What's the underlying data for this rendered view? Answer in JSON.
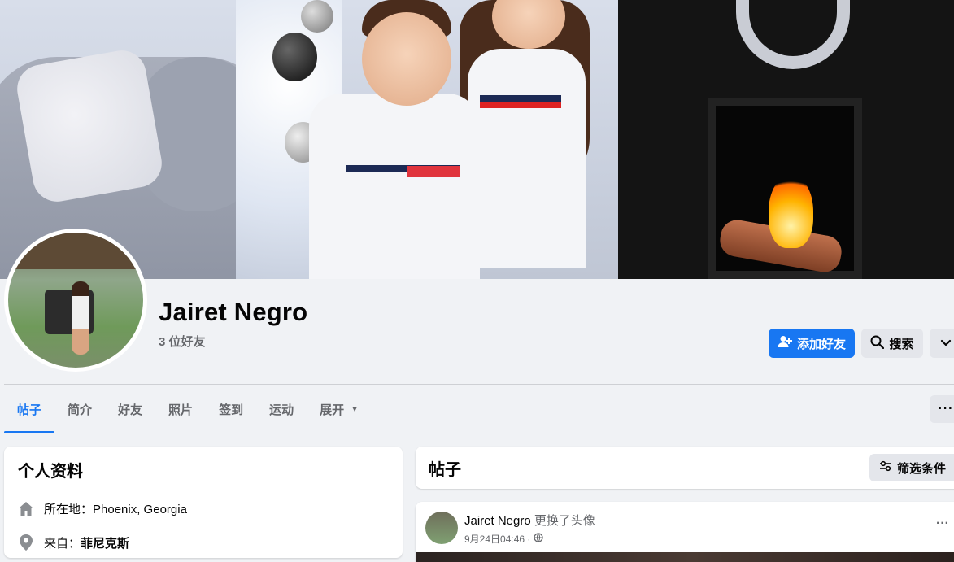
{
  "profile": {
    "name": "Jairet Negro",
    "friends_count": "3 位好友"
  },
  "actions": {
    "add_friend": "添加好友",
    "search": "搜索"
  },
  "tabs": [
    {
      "label": "帖子"
    },
    {
      "label": "简介"
    },
    {
      "label": "好友"
    },
    {
      "label": "照片"
    },
    {
      "label": "签到"
    },
    {
      "label": "运动"
    },
    {
      "label": "展开"
    }
  ],
  "intro": {
    "title": "个人资料",
    "lives_prefix": "所在地：",
    "lives_value": "Phoenix, Georgia",
    "from_prefix": "来自：",
    "from_value": "菲尼克斯"
  },
  "posts": {
    "title": "帖子",
    "filter": "筛选条件"
  },
  "post": {
    "author": "Jairet Negro",
    "action": "更换了头像",
    "time": "9月24日04:46 ·"
  },
  "colors": {
    "accent": "#1877f2",
    "background": "#f0f2f5"
  }
}
